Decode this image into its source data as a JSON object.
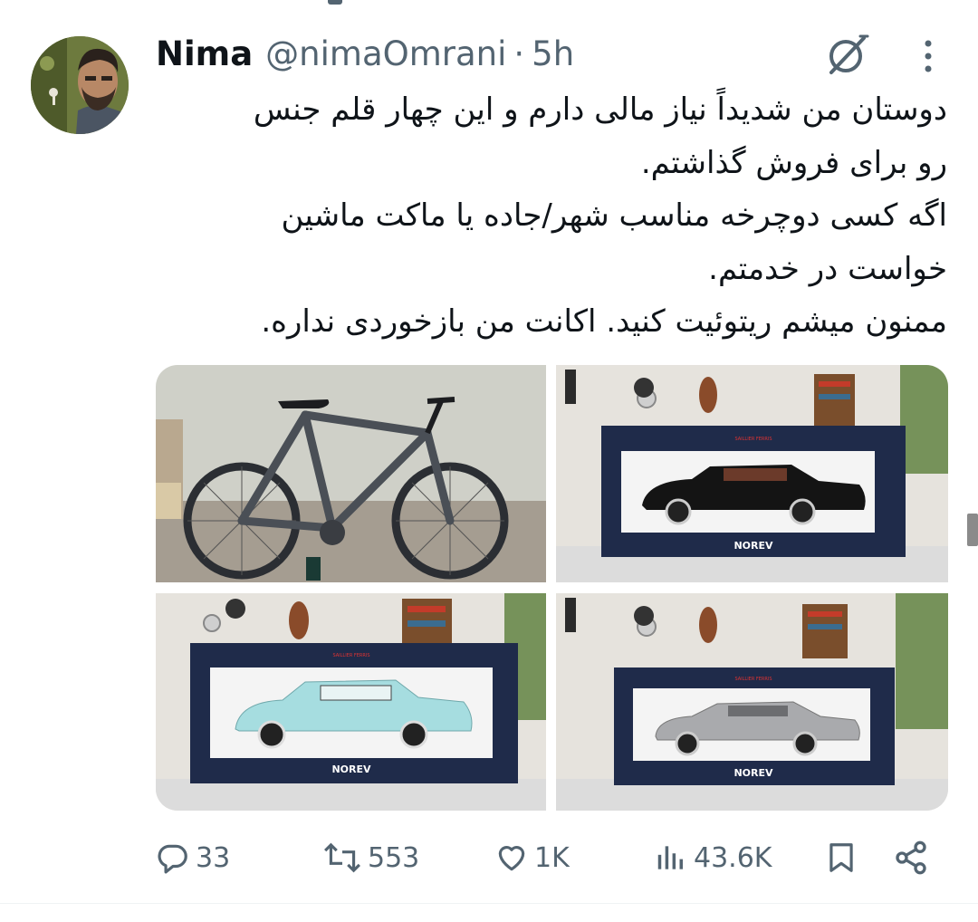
{
  "tweet": {
    "author_name": "Nima",
    "handle": "@nimaOmrani",
    "separator": "·",
    "time": "5h",
    "text_lines": [
      "دوستان من شدیداً نیاز مالی دارم و این چهار قلم جنس",
      "رو برای فروش گذاشتم.",
      "اگه کسی دوچرخه مناسب شهر/جاده یا ماکت ماشین",
      "خواست در خدمتم.",
      "ممنون میشم ریتوئیت کنید. اکانت من بازخوردی نداره."
    ]
  },
  "media": {
    "brand_label": "NOREV",
    "box_small_label": "SAILLIER FERRIS"
  },
  "actions": {
    "replies": "33",
    "reposts": "553",
    "likes": "1K",
    "views": "43.6K"
  },
  "icons": [
    "grok-icon",
    "more-icon",
    "reply-icon",
    "repost-icon",
    "like-icon",
    "views-icon",
    "bookmark-icon",
    "share-icon"
  ],
  "colors": {
    "text_primary": "#0f1419",
    "text_secondary": "#536471",
    "box_navy": "#1f2b4a"
  }
}
